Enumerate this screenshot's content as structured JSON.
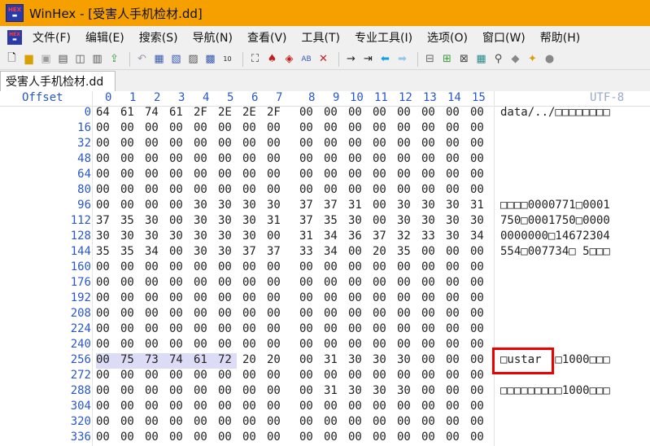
{
  "window": {
    "title": "WinHex - [受害人手机检材.dd]",
    "icon_top": "HEX",
    "icon_bottom": ""
  },
  "menu": [
    "文件(F)",
    "编辑(E)",
    "搜索(S)",
    "导航(N)",
    "查看(V)",
    "工具(T)",
    "专业工具(I)",
    "选项(O)",
    "窗口(W)",
    "帮助(H)"
  ],
  "tab": {
    "label": "受害人手机检材.dd"
  },
  "header": {
    "offset": "Offset",
    "cols": [
      "0",
      "1",
      "2",
      "3",
      "4",
      "5",
      "6",
      "7",
      "8",
      "9",
      "10",
      "11",
      "12",
      "13",
      "14",
      "15"
    ],
    "encoding": "UTF-8"
  },
  "rows": [
    {
      "off": "0",
      "bytes": [
        "64",
        "61",
        "74",
        "61",
        "2F",
        "2E",
        "2E",
        "2F",
        "00",
        "00",
        "00",
        "00",
        "00",
        "00",
        "00",
        "00"
      ],
      "text": "data/../□□□□□□□□"
    },
    {
      "off": "16",
      "bytes": [
        "00",
        "00",
        "00",
        "00",
        "00",
        "00",
        "00",
        "00",
        "00",
        "00",
        "00",
        "00",
        "00",
        "00",
        "00",
        "00"
      ],
      "text": ""
    },
    {
      "off": "32",
      "bytes": [
        "00",
        "00",
        "00",
        "00",
        "00",
        "00",
        "00",
        "00",
        "00",
        "00",
        "00",
        "00",
        "00",
        "00",
        "00",
        "00"
      ],
      "text": ""
    },
    {
      "off": "48",
      "bytes": [
        "00",
        "00",
        "00",
        "00",
        "00",
        "00",
        "00",
        "00",
        "00",
        "00",
        "00",
        "00",
        "00",
        "00",
        "00",
        "00"
      ],
      "text": ""
    },
    {
      "off": "64",
      "bytes": [
        "00",
        "00",
        "00",
        "00",
        "00",
        "00",
        "00",
        "00",
        "00",
        "00",
        "00",
        "00",
        "00",
        "00",
        "00",
        "00"
      ],
      "text": ""
    },
    {
      "off": "80",
      "bytes": [
        "00",
        "00",
        "00",
        "00",
        "00",
        "00",
        "00",
        "00",
        "00",
        "00",
        "00",
        "00",
        "00",
        "00",
        "00",
        "00"
      ],
      "text": ""
    },
    {
      "off": "96",
      "bytes": [
        "00",
        "00",
        "00",
        "00",
        "30",
        "30",
        "30",
        "30",
        "37",
        "37",
        "31",
        "00",
        "30",
        "30",
        "30",
        "31"
      ],
      "text": "□□□□0000771□0001"
    },
    {
      "off": "112",
      "bytes": [
        "37",
        "35",
        "30",
        "00",
        "30",
        "30",
        "30",
        "31",
        "37",
        "35",
        "30",
        "00",
        "30",
        "30",
        "30",
        "30"
      ],
      "text": "750□0001750□0000"
    },
    {
      "off": "128",
      "bytes": [
        "30",
        "30",
        "30",
        "30",
        "30",
        "30",
        "30",
        "00",
        "31",
        "34",
        "36",
        "37",
        "32",
        "33",
        "30",
        "34"
      ],
      "text": "0000000□14672304"
    },
    {
      "off": "144",
      "bytes": [
        "35",
        "35",
        "34",
        "00",
        "30",
        "30",
        "37",
        "37",
        "33",
        "34",
        "00",
        "20",
        "35",
        "00",
        "00",
        "00"
      ],
      "text": "554□007734□ 5□□□"
    },
    {
      "off": "160",
      "bytes": [
        "00",
        "00",
        "00",
        "00",
        "00",
        "00",
        "00",
        "00",
        "00",
        "00",
        "00",
        "00",
        "00",
        "00",
        "00",
        "00"
      ],
      "text": ""
    },
    {
      "off": "176",
      "bytes": [
        "00",
        "00",
        "00",
        "00",
        "00",
        "00",
        "00",
        "00",
        "00",
        "00",
        "00",
        "00",
        "00",
        "00",
        "00",
        "00"
      ],
      "text": ""
    },
    {
      "off": "192",
      "bytes": [
        "00",
        "00",
        "00",
        "00",
        "00",
        "00",
        "00",
        "00",
        "00",
        "00",
        "00",
        "00",
        "00",
        "00",
        "00",
        "00"
      ],
      "text": ""
    },
    {
      "off": "208",
      "bytes": [
        "00",
        "00",
        "00",
        "00",
        "00",
        "00",
        "00",
        "00",
        "00",
        "00",
        "00",
        "00",
        "00",
        "00",
        "00",
        "00"
      ],
      "text": ""
    },
    {
      "off": "224",
      "bytes": [
        "00",
        "00",
        "00",
        "00",
        "00",
        "00",
        "00",
        "00",
        "00",
        "00",
        "00",
        "00",
        "00",
        "00",
        "00",
        "00"
      ],
      "text": ""
    },
    {
      "off": "240",
      "bytes": [
        "00",
        "00",
        "00",
        "00",
        "00",
        "00",
        "00",
        "00",
        "00",
        "00",
        "00",
        "00",
        "00",
        "00",
        "00",
        "00"
      ],
      "text": ""
    },
    {
      "off": "256",
      "bytes": [
        "00",
        "75",
        "73",
        "74",
        "61",
        "72",
        "20",
        "20",
        "00",
        "31",
        "30",
        "30",
        "30",
        "00",
        "00",
        "00"
      ],
      "text": "□ustar  □1000□□□",
      "highlight": true
    },
    {
      "off": "272",
      "bytes": [
        "00",
        "00",
        "00",
        "00",
        "00",
        "00",
        "00",
        "00",
        "00",
        "00",
        "00",
        "00",
        "00",
        "00",
        "00",
        "00"
      ],
      "text": ""
    },
    {
      "off": "288",
      "bytes": [
        "00",
        "00",
        "00",
        "00",
        "00",
        "00",
        "00",
        "00",
        "00",
        "31",
        "30",
        "30",
        "30",
        "00",
        "00",
        "00"
      ],
      "text": "□□□□□□□□□1000□□□"
    },
    {
      "off": "304",
      "bytes": [
        "00",
        "00",
        "00",
        "00",
        "00",
        "00",
        "00",
        "00",
        "00",
        "00",
        "00",
        "00",
        "00",
        "00",
        "00",
        "00"
      ],
      "text": ""
    },
    {
      "off": "320",
      "bytes": [
        "00",
        "00",
        "00",
        "00",
        "00",
        "00",
        "00",
        "00",
        "00",
        "00",
        "00",
        "00",
        "00",
        "00",
        "00",
        "00"
      ],
      "text": ""
    },
    {
      "off": "336",
      "bytes": [
        "00",
        "00",
        "00",
        "00",
        "00",
        "00",
        "00",
        "00",
        "00",
        "00",
        "00",
        "00",
        "00",
        "00",
        "00",
        "00"
      ],
      "text": ""
    }
  ]
}
